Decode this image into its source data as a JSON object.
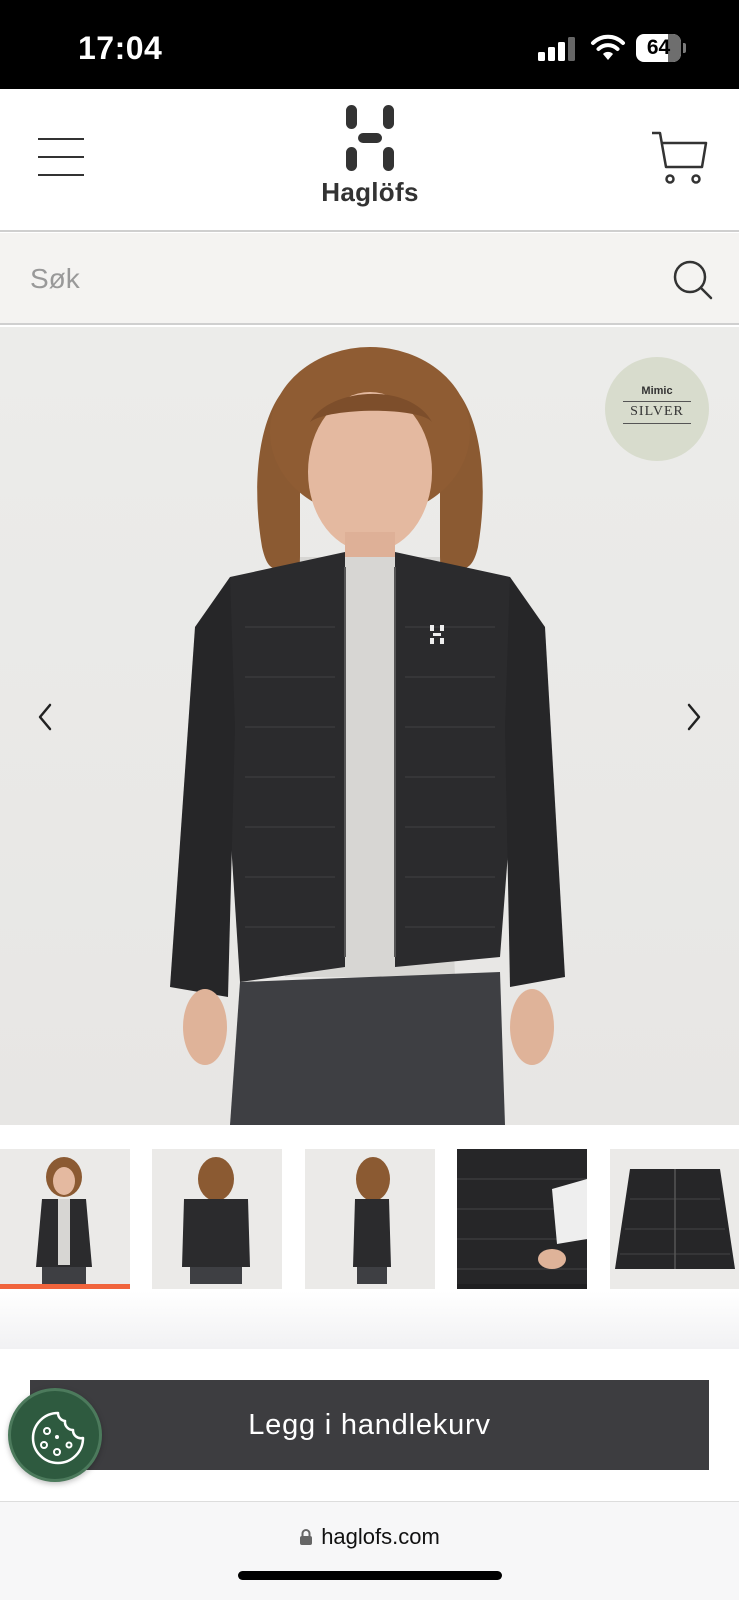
{
  "status_bar": {
    "time": "17:04",
    "battery": "64"
  },
  "header": {
    "brand": "Haglöfs"
  },
  "search": {
    "placeholder": "Søk"
  },
  "product": {
    "badge": {
      "top": "Mimic",
      "bottom": "SILVER"
    },
    "thumbnails": [
      "front view",
      "back view",
      "side view",
      "detail pocket",
      "flat lay"
    ],
    "active_thumbnail": 1
  },
  "cta": {
    "add_to_cart_label": "Legg i handlekurv"
  },
  "browser": {
    "url": "haglofs.com"
  },
  "colors": {
    "accent": "#f0643c",
    "button": "#3d3d40",
    "cookie": "#2e5a3f",
    "badge": "#d8dccd"
  }
}
